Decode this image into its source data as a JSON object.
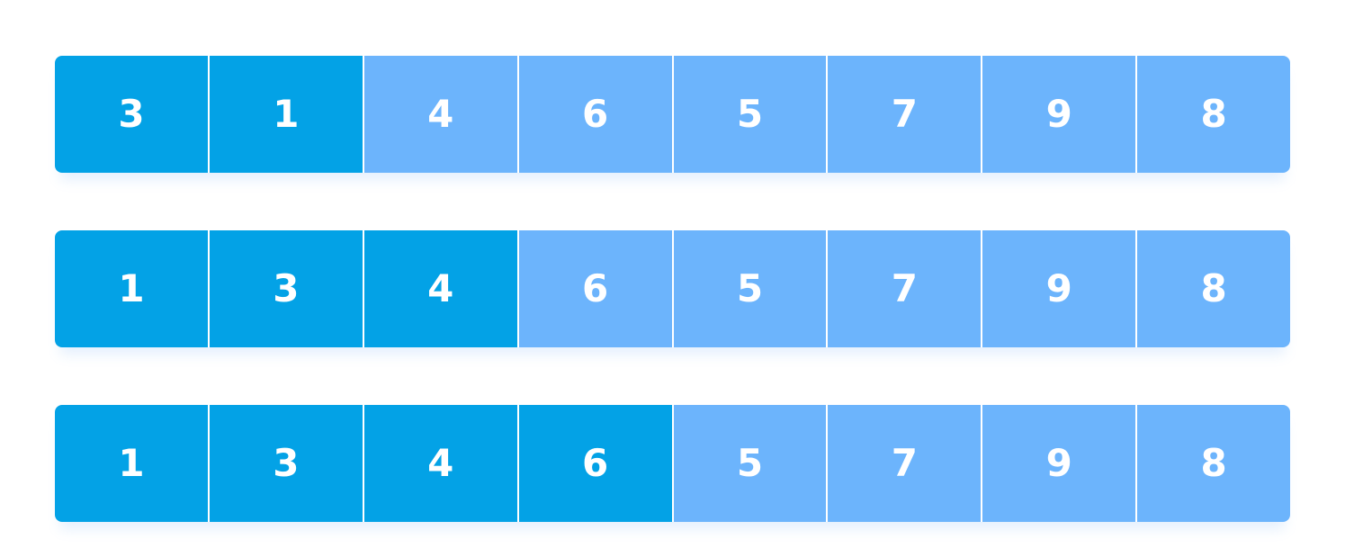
{
  "colors": {
    "sorted": "#03a2e6",
    "unsorted": "#6cb4fc",
    "background": "#ffffff",
    "text": "#ffffff"
  },
  "rows": [
    {
      "values": [
        "3",
        "1",
        "4",
        "6",
        "5",
        "7",
        "9",
        "8"
      ],
      "sorted_count": 2
    },
    {
      "values": [
        "1",
        "3",
        "4",
        "6",
        "5",
        "7",
        "9",
        "8"
      ],
      "sorted_count": 3
    },
    {
      "values": [
        "1",
        "3",
        "4",
        "6",
        "5",
        "7",
        "9",
        "8"
      ],
      "sorted_count": 4
    }
  ]
}
